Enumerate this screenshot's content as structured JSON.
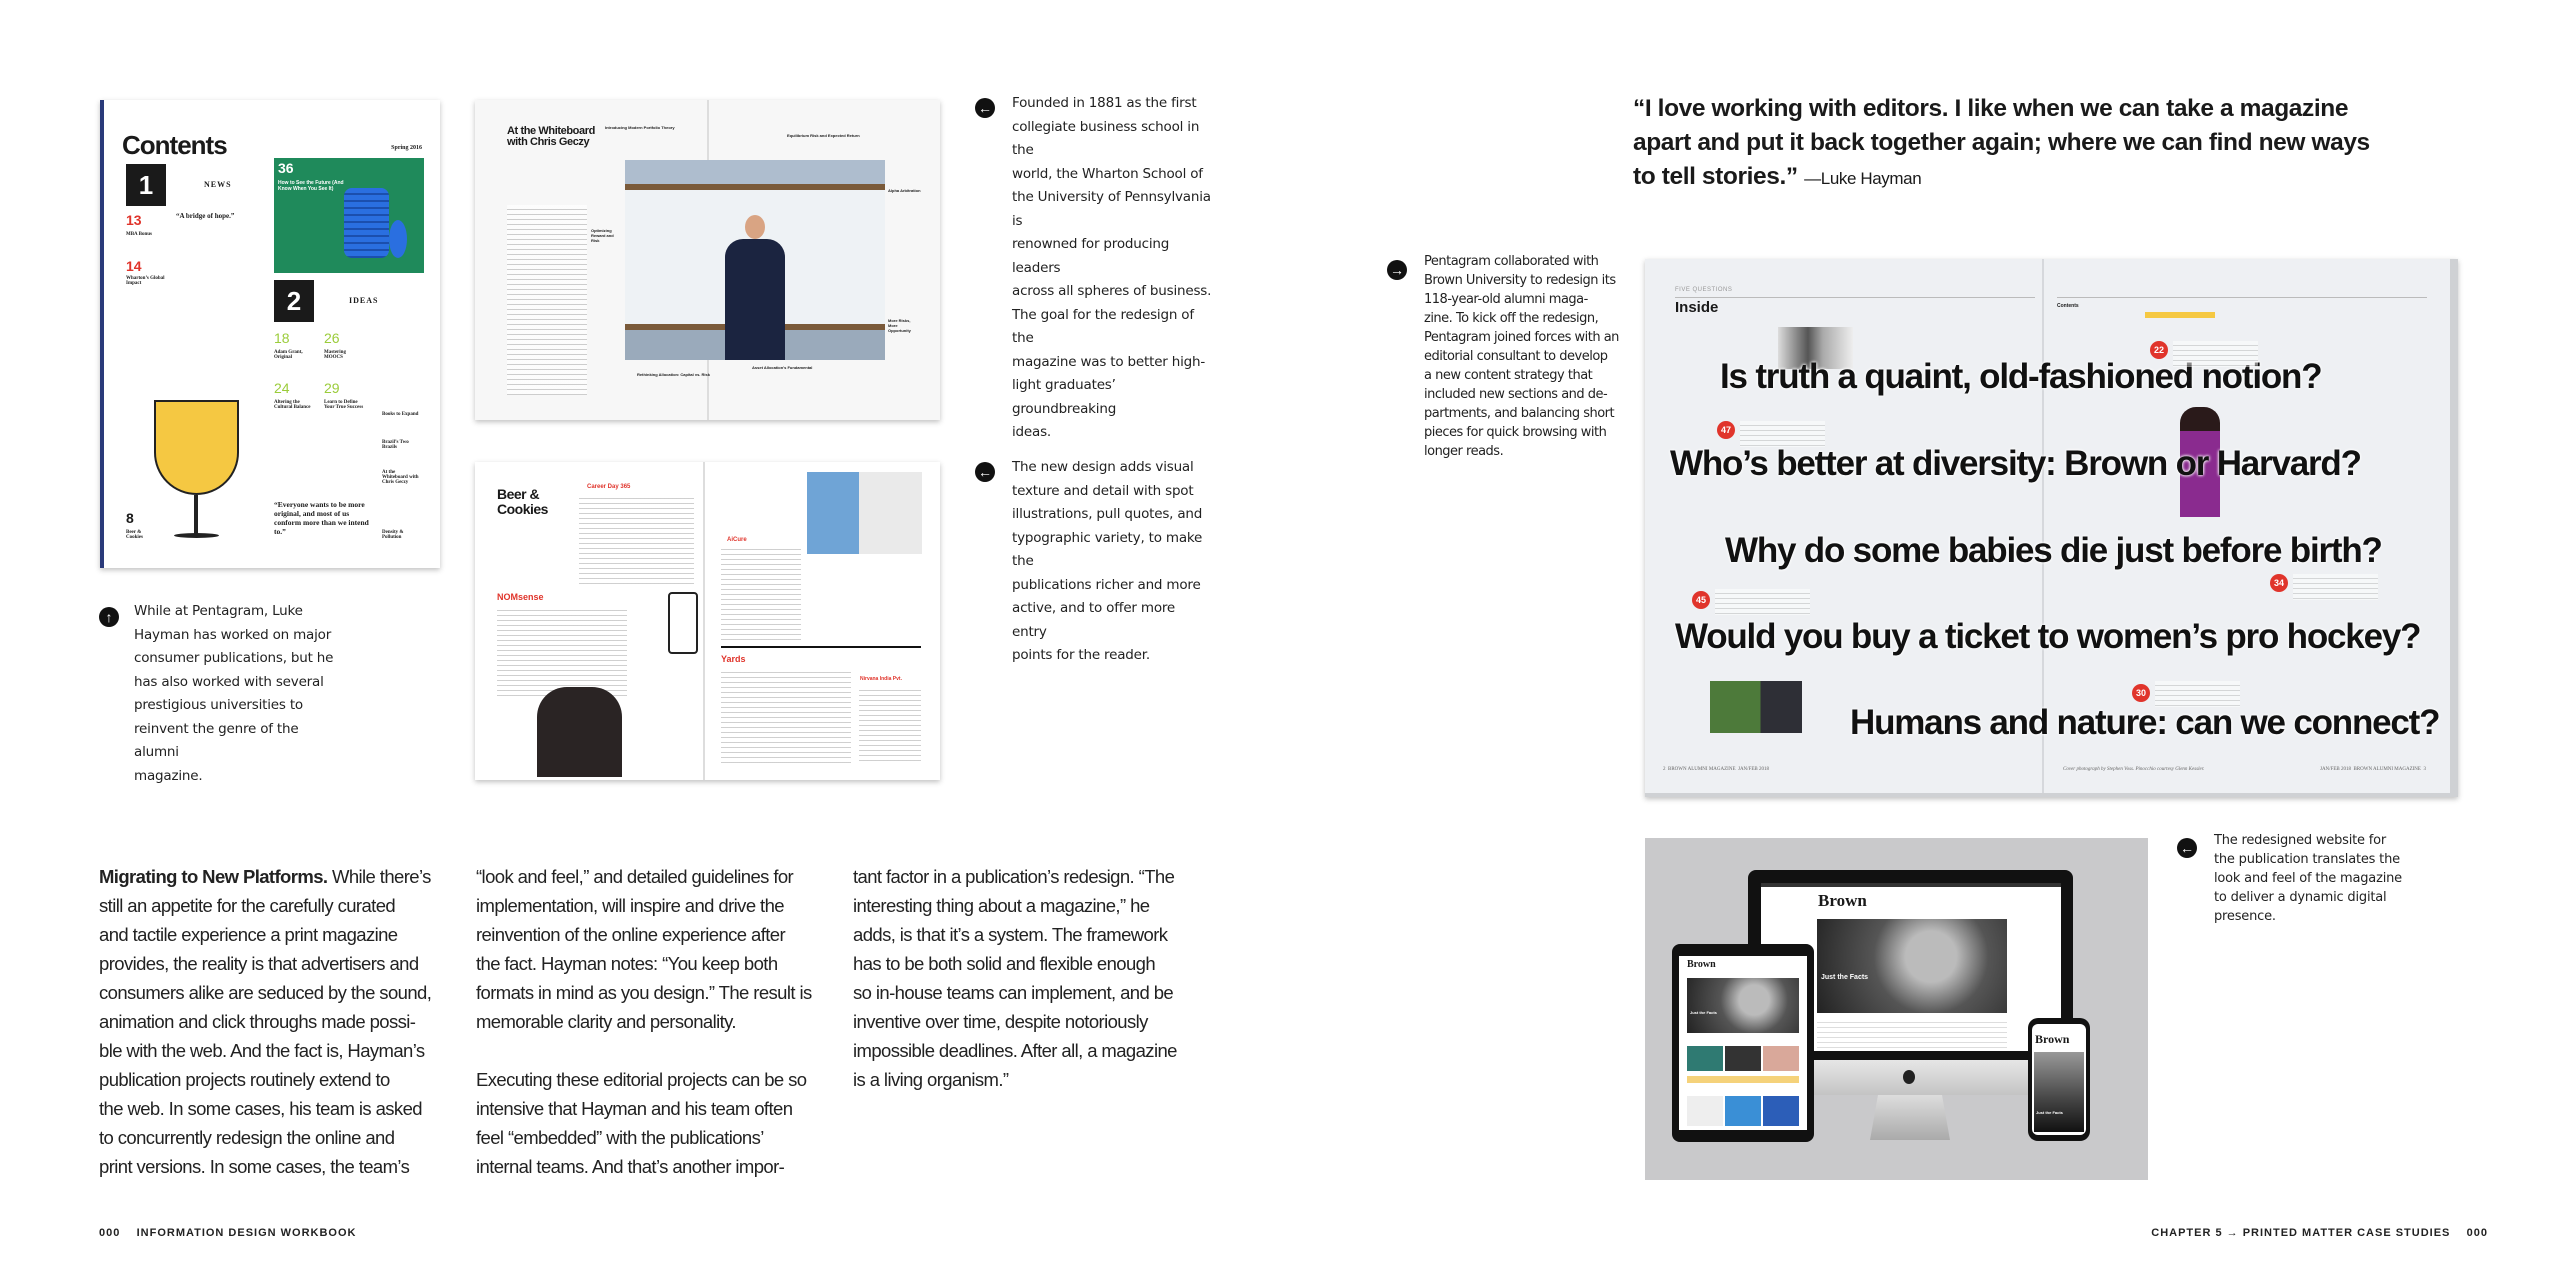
{
  "captions": {
    "wharton": {
      "icon": "arrow-left-icon",
      "lines": [
        "Founded in 1881 as the first",
        "collegiate business school in the",
        "world, the Wharton School of",
        "the University of Pennsylvania is",
        "renowned for producing leaders",
        "across all spheres of business.",
        "The goal for the redesign of the",
        "magazine was to better high-",
        "light graduates’ groundbreaking",
        "ideas."
      ]
    },
    "new_design": {
      "icon": "arrow-left-icon",
      "lines": [
        "The new design adds visual",
        "texture and detail with spot",
        "illustrations, pull quotes, and",
        "typographic variety, to make the",
        "publications richer and more",
        "active, and to offer more entry",
        "points for the reader."
      ]
    },
    "pentagram_hayman": {
      "icon": "arrow-up-icon",
      "lines": [
        "While at Pentagram, Luke",
        "Hayman has worked on major",
        "consumer publications, but he",
        "has also worked with several",
        "prestigious universities to",
        "reinvent the genre of the alumni",
        "magazine."
      ]
    },
    "brown": {
      "icon": "arrow-right-icon",
      "lines": [
        "Pentagram collaborated with",
        "Brown University to redesign its",
        "118-year-old alumni maga-",
        "zine. To kick off the redesign,",
        "Pentagram joined forces with an",
        "editorial consultant to develop",
        "a new content strategy that",
        "included new sections and de-",
        "partments, and balancing short",
        "pieces for quick browsing with",
        "longer reads."
      ]
    },
    "website": {
      "icon": "arrow-left-icon",
      "lines": [
        "The redesigned website for",
        "the publication translates the",
        "look and feel of the magazine",
        "to deliver a dynamic digital",
        "presence."
      ]
    }
  },
  "body": {
    "heading": "Migrating to New Platforms.",
    "col1": [
      "While there’s",
      "still an appetite for the carefully curated",
      "and tactile experience a print magazine",
      "provides, the reality is that advertisers and",
      "consumers alike are seduced by the sound,",
      "animation and click throughs made possi-",
      "ble with the web. And the fact is, Hayman’s",
      "publication projects routinely extend to",
      "the web. In some cases, his team is asked",
      "to concurrently redesign the online and",
      "print versions. In some cases, the team’s"
    ],
    "col2a": [
      "“look and feel,” and detailed guidelines for",
      "implementation, will inspire and drive the",
      "reinvention of the online experience after",
      "the fact. Hayman notes: “You keep both",
      "formats in mind as you design.” The result is",
      "memorable clarity and personality."
    ],
    "col2b": [
      "Executing these editorial projects can be so",
      "intensive that Hayman and his team often",
      "feel “embedded” with the publications’",
      "internal teams. And that’s another impor-"
    ],
    "col3": [
      "tant factor in a publication’s redesign. “The",
      "interesting thing about a magazine,” he",
      "adds, is that it’s a system. The framework",
      "has to be both solid and flexible enough",
      "so in-house teams can implement, and be",
      "inventive over time, despite notoriously",
      "impossible deadlines. After all, a magazine",
      "is a living organism.”"
    ]
  },
  "quote": {
    "text": "“I love working with editors. I like when we can take a magazine apart and put it back together again; where we can find new ways to tell stories.”",
    "attribution": "—Luke Hayman"
  },
  "footer": {
    "left_page": "000",
    "left_title": "INFORMATION DESIGN WORKBOOK",
    "right_title": "CHAPTER 5 → PRINTED MATTER CASE STUDIES",
    "right_page": "000"
  },
  "contents_page": {
    "title": "Contents",
    "issue": "Spring 2016",
    "sections": [
      {
        "num": "1",
        "label": "NEWS"
      },
      {
        "num": "2",
        "label": "IDEAS"
      }
    ],
    "quote1": "“A bridge of hope.”",
    "quote2": "“Everyone wants to be more original, and most of us conform more than we intend to.”",
    "items": [
      {
        "num": "13",
        "title": "MBA Bonus"
      },
      {
        "num": "14",
        "title": "Wharton’s Global Impact"
      },
      {
        "num": "36",
        "title": "How to See the Future (And Know When You See It)"
      },
      {
        "num": "18",
        "title": "Adam Grant, Original"
      },
      {
        "num": "26",
        "title": "Mastering MOOCS"
      },
      {
        "num": "24",
        "title": "Altering the Cultural Balance"
      },
      {
        "num": "29",
        "title": "Learn to Define Your True Success"
      },
      {
        "num": "8",
        "title": "Beer & Cookies"
      }
    ],
    "sidebar": [
      "Books to Expand",
      "Brazil’s Two Brazils",
      "At the Whiteboard with Chris Geczy",
      "Density & Pollution"
    ],
    "accent_green": "#1f8a5b",
    "accent_red": "#e0342b"
  },
  "whiteboard_spread": {
    "title": "At the Whiteboard with Chris Geczy",
    "annotations": [
      "Introducing Modern Portfolio Theory",
      "Equilibrium Risk and Expected Return",
      "Optimizing Reward and Risk",
      "Alpha Arbitration",
      "More Risks, More Opportunity",
      "Rethinking Allocation: Capital vs. Risk",
      "Asset Allocation's Fundamental"
    ]
  },
  "beer_spread": {
    "title": "Beer & Cookies",
    "headings": [
      "Career Day 365",
      "NOMsense",
      "AiCure",
      "Yards",
      "Nirvana India Pvt."
    ],
    "accent": "#e0342b"
  },
  "brown_spread": {
    "kicker": "FIVE QUESTIONS",
    "label": "Inside",
    "contents_label": "Contents",
    "headlines": [
      "Is truth a quaint, old-fashioned notion?",
      "Who’s better at diversity: Brown or Harvard?",
      "Why do some babies die just before birth?",
      "Would you buy a ticket to women’s pro hockey?",
      "Humans and nature: can we connect?"
    ],
    "page_numbers": [
      "22",
      "47",
      "34",
      "45",
      "30"
    ],
    "footer_left": "2  BROWN ALUMNI MAGAZINE  JAN/FEB 2018",
    "footer_credit": "Cover photograph by Stephen Voss. Pinocchio courtesy Glenn Kessler.",
    "footer_right": "JAN/FEB 2018  BROWN ALUMNI MAGAZINE  3",
    "accent": "#e0342b"
  },
  "website_mockup": {
    "brand": "Brown",
    "feature": "Just the Facts",
    "background": "#c9c9cb"
  }
}
